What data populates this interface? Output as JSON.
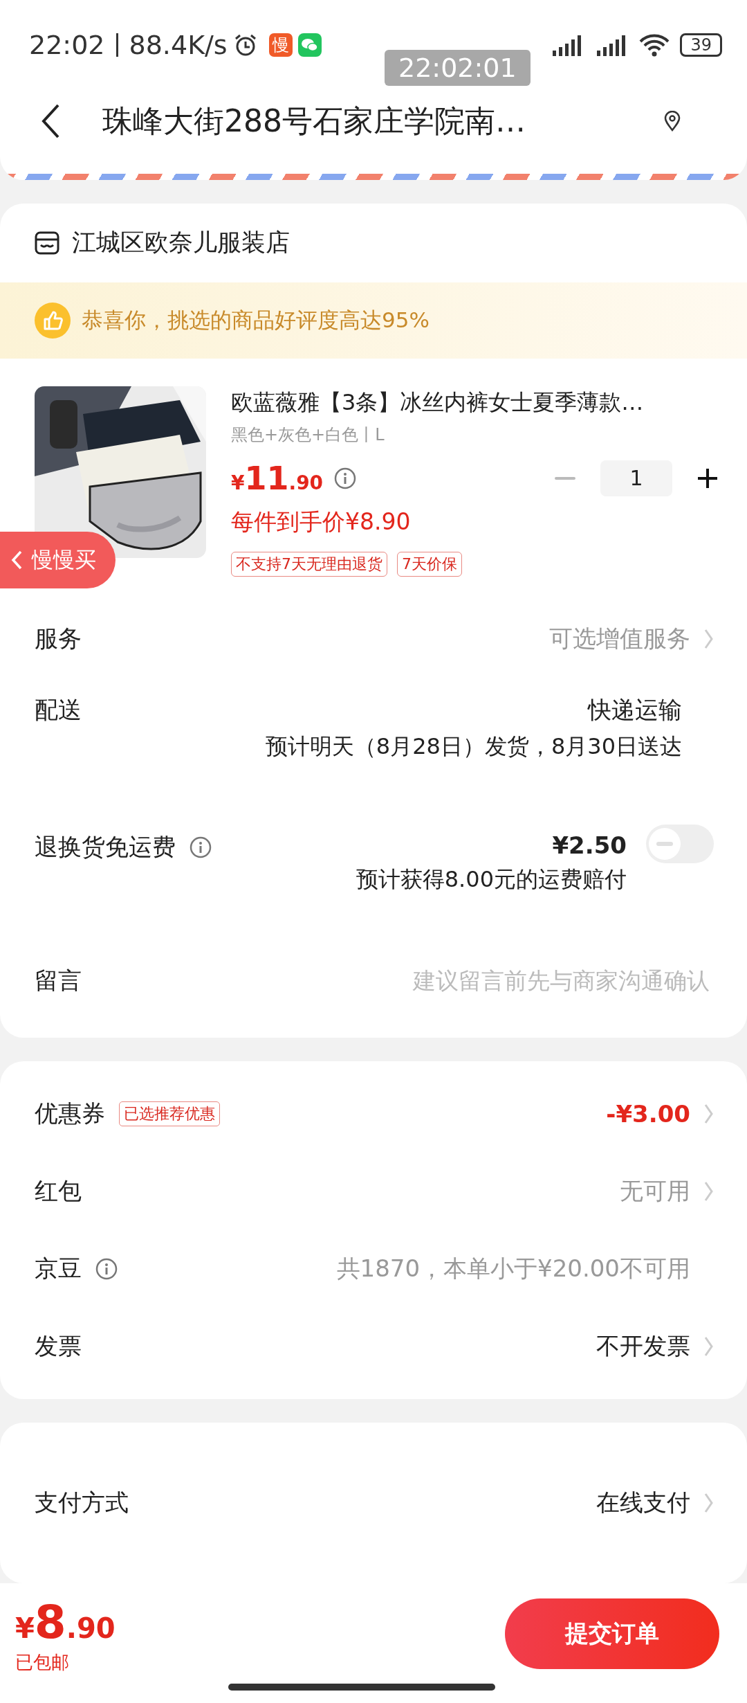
{
  "status_bar": {
    "time": "22:02",
    "speed": "88.4K/s",
    "slow_badge": "慢",
    "battery": "39"
  },
  "time_toast": "22:02:01",
  "header": {
    "address": "珠峰大街288号石家庄学院南…"
  },
  "store": {
    "name": "江城区欧奈儿服装店"
  },
  "banner": "恭喜你，挑选的商品好评度高达95%",
  "product": {
    "title": "欧蓝薇雅【3条】冰丝内裤女士夏季薄款…",
    "spec": "黑色+灰色+白色丨L",
    "currency": "¥",
    "price_int": "11",
    "price_dec": ".90",
    "unit_price": "每件到手价¥8.90",
    "quantity": "1",
    "tags": [
      "不支持7天无理由退货",
      "7天价保"
    ]
  },
  "float_button": "慢慢买",
  "cards": [
    {
      "rows": [
        {
          "kind": "link",
          "label": "服务",
          "value": "可选增值服务",
          "color": "#999999"
        },
        {
          "kind": "delivery",
          "label": "配送",
          "value": "快递运输",
          "note": "预计明天（8月28日）发货，8月30日送达"
        },
        {
          "kind": "toggle",
          "label": "退换货免运费",
          "info": true,
          "value": "¥2.50",
          "note": "预计获得8.00元的运费赔付",
          "on": false
        },
        {
          "kind": "input",
          "label": "留言",
          "placeholder": "建议留言前先与商家沟通确认"
        }
      ]
    },
    {
      "rows": [
        {
          "kind": "link",
          "label": "优惠券",
          "badge": "已选推荐优惠",
          "value": "-¥3.00",
          "color": "#e3261c"
        },
        {
          "kind": "link",
          "label": "红包",
          "value": "无可用",
          "color": "#999999"
        },
        {
          "kind": "plain",
          "label": "京豆",
          "info": true,
          "value": "共1870，本单小于¥20.00不可用",
          "color": "#999999"
        },
        {
          "kind": "link",
          "label": "发票",
          "value": "不开发票",
          "color": "#222222"
        }
      ]
    },
    {
      "rows": [
        {
          "kind": "link",
          "label": "支付方式",
          "value": "在线支付",
          "color": "#222222"
        }
      ]
    }
  ],
  "footer": {
    "currency": "¥",
    "price_int": "8",
    "price_dec": ".90",
    "shipping": "已包邮",
    "submit": "提交订单"
  }
}
